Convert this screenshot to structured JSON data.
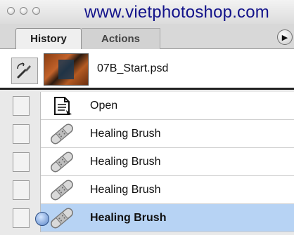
{
  "window": {
    "watermark": "www.vietphotoshop.com"
  },
  "tabs": [
    {
      "label": "History",
      "active": true
    },
    {
      "label": "Actions",
      "active": false
    }
  ],
  "panel_menu": {
    "icon": "triangle-right-icon"
  },
  "snapshot": {
    "label": "07B_Start.psd",
    "icon": "history-brush-icon"
  },
  "history": [
    {
      "label": "Open",
      "icon": "document-open-icon",
      "selected": false
    },
    {
      "label": "Healing Brush",
      "icon": "healing-brush-icon",
      "selected": false
    },
    {
      "label": "Healing Brush",
      "icon": "healing-brush-icon",
      "selected": false
    },
    {
      "label": "Healing Brush",
      "icon": "healing-brush-icon",
      "selected": false
    },
    {
      "label": "Healing Brush",
      "icon": "healing-brush-icon",
      "selected": true
    }
  ],
  "colors": {
    "selected_row": "#b7d3f4",
    "watermark": "#12128a"
  }
}
